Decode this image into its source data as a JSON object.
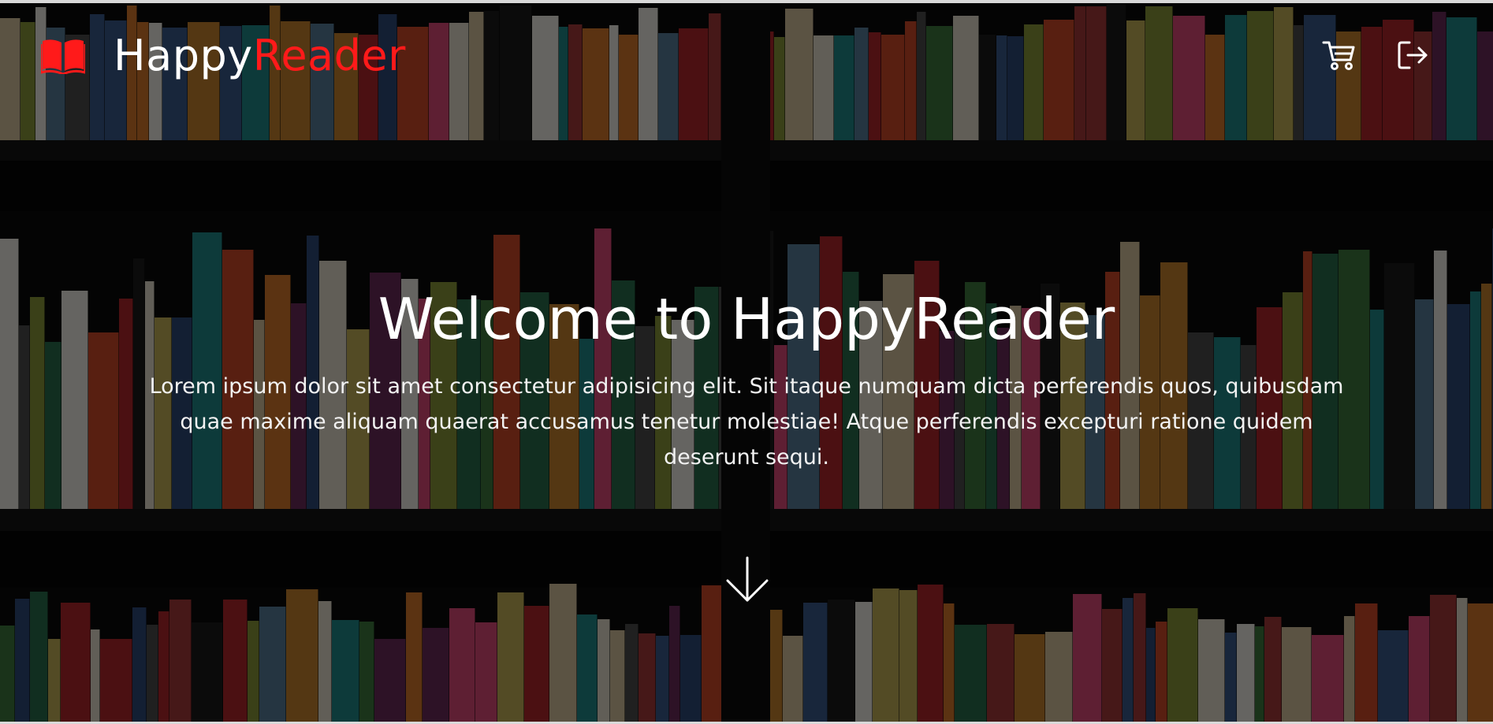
{
  "brand": {
    "name_prefix": "Happy",
    "name_accent": "Reader",
    "icon": "book-open-icon",
    "accent_color": "#ff1a1a"
  },
  "nav": {
    "cart": {
      "icon": "cart-icon",
      "label": "Cart"
    },
    "logout": {
      "icon": "logout-icon",
      "label": "Log out"
    }
  },
  "hero": {
    "title": "Welcome to HappyReader",
    "description": "Lorem ipsum dolor sit amet consectetur adipisicing elit. Sit itaque numquam dicta perferendis quos, quibusdam quae maxime aliquam quaerat accusamus tenetur molestiae! Atque perferendis excepturi ratione quidem deserunt sequi.",
    "scroll_icon": "arrow-down-icon"
  }
}
